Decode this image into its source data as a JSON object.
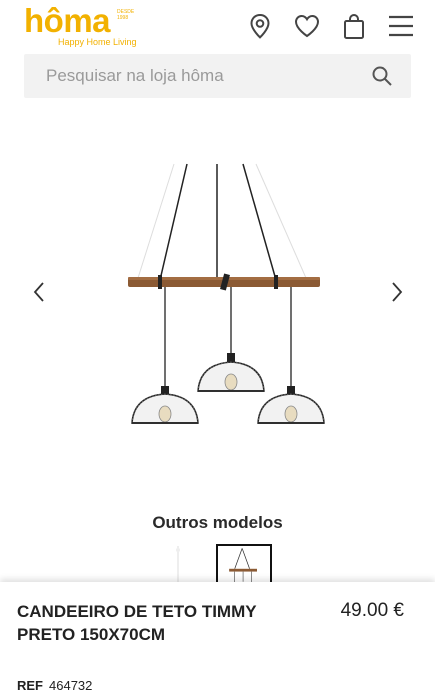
{
  "brand": {
    "name": "hôma",
    "est": "DESDE 1998",
    "tagline": "Happy Home Living",
    "color": "#f2b100"
  },
  "header": {
    "icons": [
      "location-pin-icon",
      "heart-icon",
      "shopping-bag-icon",
      "menu-icon"
    ]
  },
  "search": {
    "placeholder": "Pesquisar na loja hôma"
  },
  "gallery": {
    "prev_icon": "chevron-left-icon",
    "next_icon": "chevron-right-icon"
  },
  "other_models": {
    "title": "Outros modelos"
  },
  "product": {
    "name": "CANDEEIRO DE TETO TIMMY PRETO 150X70CM",
    "price": "49.00 €",
    "ref_label": "REF",
    "ref_value": "464732"
  }
}
